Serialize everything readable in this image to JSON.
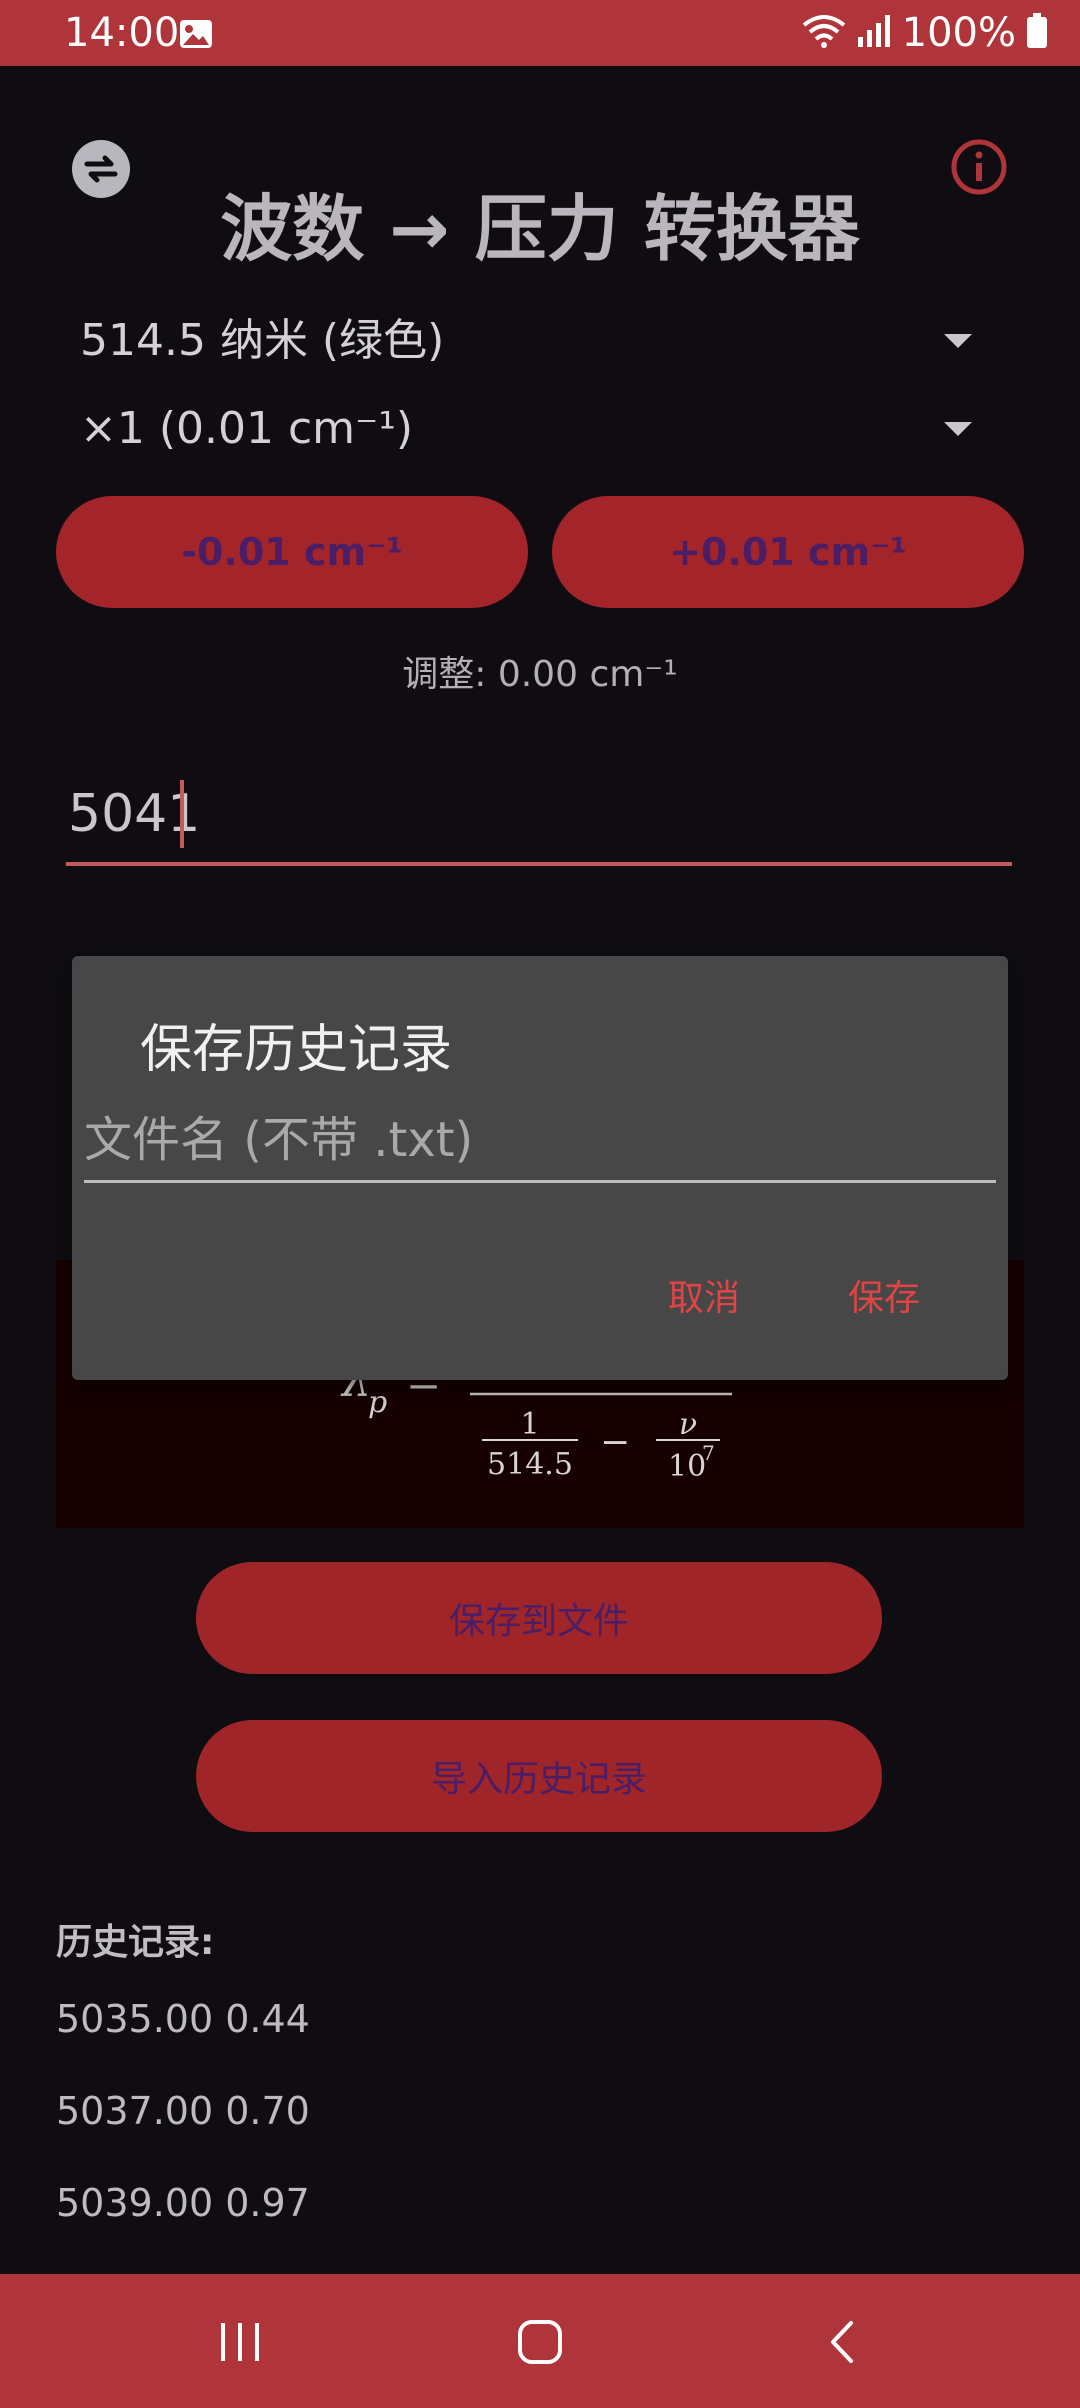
{
  "status": {
    "time": "14:00",
    "battery": "100%",
    "icons": [
      "gallery-icon",
      "wifi-icon",
      "signal-icon",
      "battery-icon"
    ]
  },
  "header": {
    "title": "波数 → 压力 转换器",
    "left_icon": "swap-icon",
    "right_icon": "info-icon"
  },
  "dropdowns": {
    "laser": "514.5 纳米 (绿色)",
    "step": "×1 (0.01 cm⁻¹)"
  },
  "adjust": {
    "minus_label": "-0.01 cm⁻¹",
    "plus_label": "+0.01 cm⁻¹",
    "status": "调整: 0.00 cm⁻¹"
  },
  "input": {
    "value": "5041"
  },
  "formula": {
    "lhs": "λ",
    "lhs_sub": "p",
    "equals": "=",
    "num1": "1",
    "den1": "514.5",
    "minus": "−",
    "num2": "ν",
    "den2_base": "10",
    "den2_exp": "7"
  },
  "buttons": {
    "save_to_file": "保存到文件",
    "import_history": "导入历史记录"
  },
  "history": {
    "title": "历史记录:",
    "items": [
      "5035.00 0.44",
      "5037.00 0.70",
      "5039.00 0.97"
    ]
  },
  "dialog": {
    "title": "保存历史记录",
    "placeholder": "文件名 (不带 .txt)",
    "cancel": "取消",
    "save": "保存"
  },
  "colors": {
    "accent": "#b0353a",
    "pill": "#a42529",
    "pill_text": "#4a1e66",
    "background": "#0f0d12",
    "dialog_bg": "#474747",
    "dialog_action": "#e04545"
  }
}
